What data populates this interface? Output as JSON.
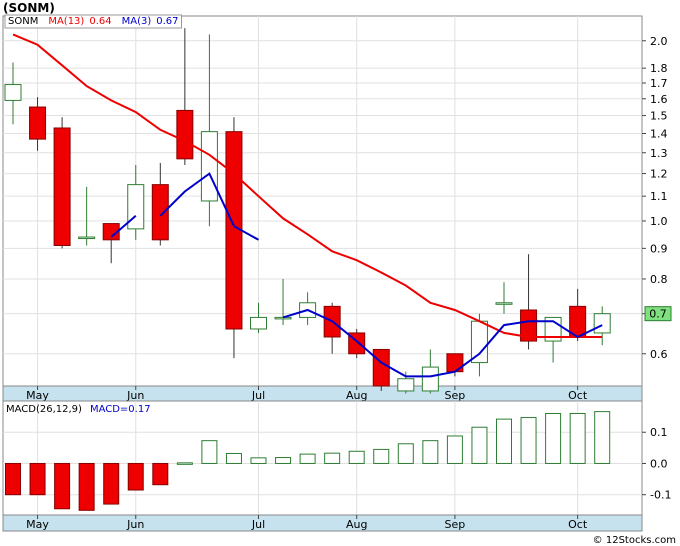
{
  "title": "(SONM)",
  "footer": "© 12Stocks.com",
  "colors": {
    "up_fill": "#ffffff",
    "up_stroke": "#2e7d32",
    "down_fill": "#ee0000",
    "down_stroke": "#880000",
    "ma13": "#ee0000",
    "ma3": "#0000cc",
    "macd_pos": "#2e7d32",
    "macd_neg": "#ee0000",
    "axis_band": "#c6e2ee",
    "grid": "#e0e0e0",
    "price_tag": "#7ee07e"
  },
  "chart_data": [
    {
      "type": "candlestick",
      "legend": {
        "symbol": "SONM",
        "ma13_label": "MA(13)",
        "ma13_value": "0.64",
        "ma3_label": "MA(3)",
        "ma3_value": "0.67"
      },
      "y_scale": "log",
      "ylim": [
        0.53,
        2.2
      ],
      "y_ticks": [
        0.6,
        0.7,
        0.8,
        0.9,
        1.0,
        1.1,
        1.2,
        1.3,
        1.4,
        1.5,
        1.6,
        1.7,
        1.8,
        2.0
      ],
      "y_tick_labels": [
        "0.6",
        "0.7",
        "0.8",
        "0.9",
        "1.0",
        "1.1",
        "1.2",
        "1.3",
        "1.4",
        "1.5",
        "1.6",
        "1.7",
        "1.8",
        "2.0"
      ],
      "x_labels": [
        {
          "label": "May",
          "index": 1
        },
        {
          "label": "Jun",
          "index": 5
        },
        {
          "label": "Jul",
          "index": 10
        },
        {
          "label": "Aug",
          "index": 14
        },
        {
          "label": "Sep",
          "index": 18
        },
        {
          "label": "Oct",
          "index": 23
        }
      ],
      "last_price_label": "0.7",
      "last_price": 0.7,
      "candles": [
        {
          "o": 1.59,
          "h": 1.84,
          "l": 1.45,
          "c": 1.69
        },
        {
          "o": 1.55,
          "h": 1.61,
          "l": 1.31,
          "c": 1.37
        },
        {
          "o": 1.43,
          "h": 1.49,
          "l": 0.9,
          "c": 0.91
        },
        {
          "o": 0.94,
          "h": 1.14,
          "l": 0.91,
          "c": 0.94
        },
        {
          "o": 0.99,
          "h": 0.99,
          "l": 0.85,
          "c": 0.93
        },
        {
          "o": 0.97,
          "h": 1.24,
          "l": 0.93,
          "c": 1.15
        },
        {
          "o": 1.15,
          "h": 1.25,
          "l": 0.91,
          "c": 0.93
        },
        {
          "o": 1.53,
          "h": 2.1,
          "l": 1.24,
          "c": 1.27
        },
        {
          "o": 1.08,
          "h": 2.05,
          "l": 0.98,
          "c": 1.41
        },
        {
          "o": 1.41,
          "h": 1.49,
          "l": 0.59,
          "c": 0.66
        },
        {
          "o": 0.66,
          "h": 0.73,
          "l": 0.65,
          "c": 0.69
        },
        {
          "o": 0.69,
          "h": 0.8,
          "l": 0.67,
          "c": 0.69
        },
        {
          "o": 0.69,
          "h": 0.76,
          "l": 0.67,
          "c": 0.73
        },
        {
          "o": 0.72,
          "h": 0.73,
          "l": 0.6,
          "c": 0.64
        },
        {
          "o": 0.65,
          "h": 0.66,
          "l": 0.59,
          "c": 0.6
        },
        {
          "o": 0.61,
          "h": 0.61,
          "l": 0.52,
          "c": 0.53
        },
        {
          "o": 0.52,
          "h": 0.56,
          "l": 0.515,
          "c": 0.545
        },
        {
          "o": 0.52,
          "h": 0.61,
          "l": 0.515,
          "c": 0.57
        },
        {
          "o": 0.6,
          "h": 0.6,
          "l": 0.55,
          "c": 0.56
        },
        {
          "o": 0.58,
          "h": 0.7,
          "l": 0.55,
          "c": 0.68
        },
        {
          "o": 0.73,
          "h": 0.79,
          "l": 0.7,
          "c": 0.73
        },
        {
          "o": 0.71,
          "h": 0.88,
          "l": 0.61,
          "c": 0.63
        },
        {
          "o": 0.63,
          "h": 0.69,
          "l": 0.58,
          "c": 0.69
        },
        {
          "o": 0.72,
          "h": 0.77,
          "l": 0.63,
          "c": 0.64
        },
        {
          "o": 0.65,
          "h": 0.72,
          "l": 0.62,
          "c": 0.7
        }
      ],
      "ma13": [
        2.05,
        1.97,
        1.82,
        1.68,
        1.59,
        1.52,
        1.42,
        1.36,
        1.29,
        1.2,
        1.1,
        1.01,
        0.95,
        0.89,
        0.86,
        0.82,
        0.78,
        0.73,
        0.71,
        0.68,
        0.65,
        0.64,
        0.64,
        0.64,
        0.64
      ],
      "ma13_start": 0,
      "ma3": [
        0.94,
        1.02,
        1.02,
        1.12,
        1.2,
        0.98,
        0.93,
        0.69,
        0.71,
        0.68,
        0.63,
        0.58,
        0.55,
        0.55,
        0.56,
        0.6,
        0.67,
        0.68,
        0.68,
        0.64,
        0.67
      ],
      "ma3_start": 4,
      "ma3_gaps": [
        6,
        11
      ]
    },
    {
      "type": "bar",
      "legend": {
        "macd_label": "MACD(26,12,9)",
        "macd_value_label": "MACD=0.17"
      },
      "ylim": [
        -0.165,
        0.2
      ],
      "y_ticks": [
        0.1,
        0.0,
        -0.1
      ],
      "y_tick_labels": [
        "0.1",
        "0.0",
        "-0.1"
      ],
      "x_labels": [
        {
          "label": "May",
          "index": 1
        },
        {
          "label": "Jun",
          "index": 5
        },
        {
          "label": "Jul",
          "index": 10
        },
        {
          "label": "Aug",
          "index": 14
        },
        {
          "label": "Sep",
          "index": 18
        },
        {
          "label": "Oct",
          "index": 23
        }
      ],
      "values": [
        -0.1,
        -0.1,
        -0.145,
        -0.15,
        -0.13,
        -0.085,
        -0.068,
        0.002,
        0.073,
        0.032,
        0.018,
        0.019,
        0.03,
        0.033,
        0.039,
        0.045,
        0.063,
        0.073,
        0.088,
        0.116,
        0.142,
        0.147,
        0.16,
        0.16,
        0.166
      ]
    }
  ]
}
